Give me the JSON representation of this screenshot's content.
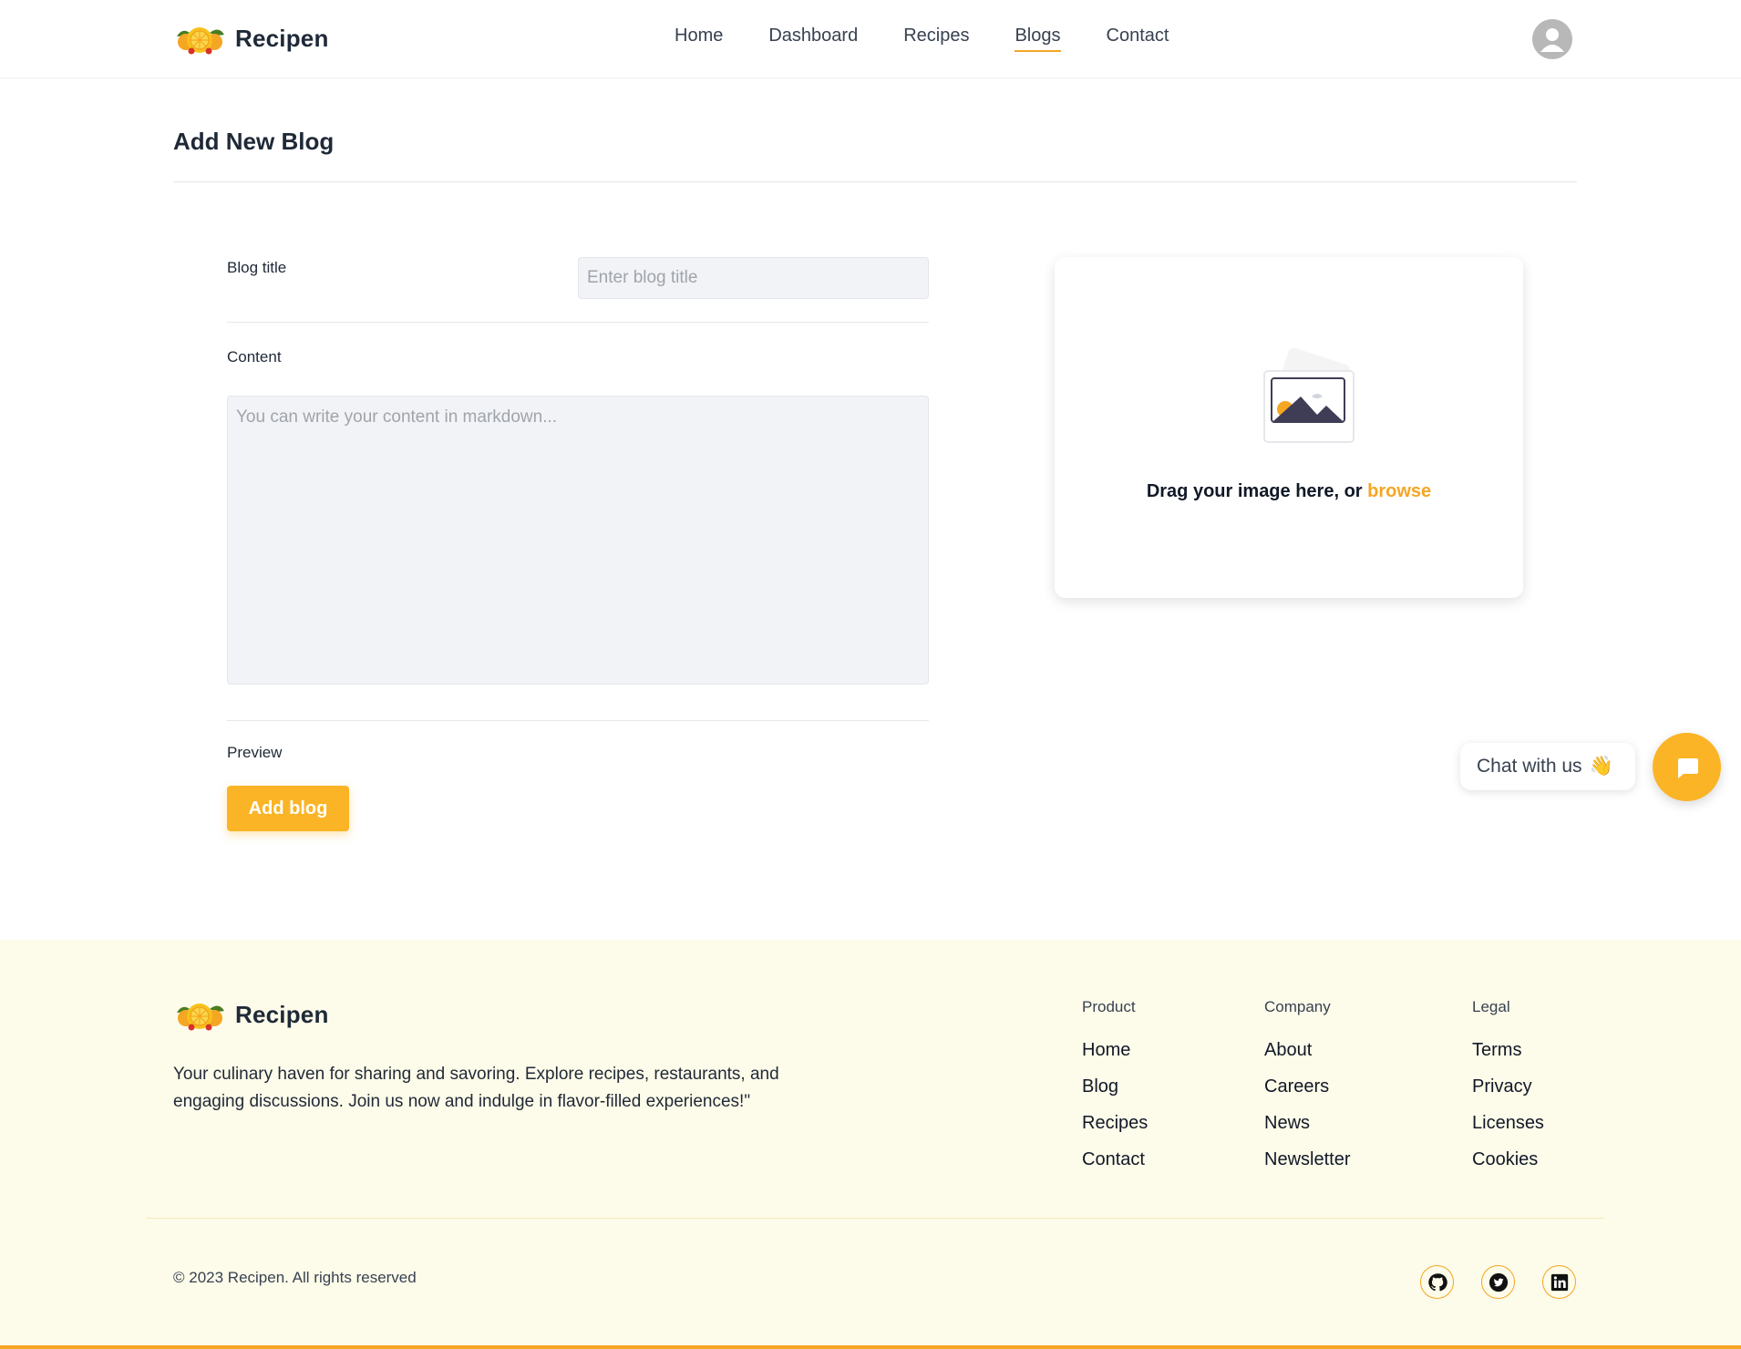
{
  "brand": {
    "name": "Recipen",
    "logo_icon": "citrus-logo-icon"
  },
  "nav": {
    "items": [
      {
        "label": "Home",
        "active": false
      },
      {
        "label": "Dashboard",
        "active": false
      },
      {
        "label": "Recipes",
        "active": false
      },
      {
        "label": "Blogs",
        "active": true
      },
      {
        "label": "Contact",
        "active": false
      }
    ],
    "avatar_icon": "user-avatar-icon"
  },
  "page": {
    "title": "Add New Blog"
  },
  "form": {
    "title_label": "Blog title",
    "title_placeholder": "Enter blog title",
    "title_value": "",
    "content_label": "Content",
    "content_placeholder": "You can write your content in markdown...",
    "content_value": "",
    "preview_label": "Preview",
    "submit_label": "Add blog"
  },
  "dropzone": {
    "text": "Drag your image here, or ",
    "browse": "browse",
    "icon": "image-placeholder-icon"
  },
  "chat": {
    "label": "Chat with us",
    "emoji": "👋",
    "button_icon": "chat-bubble-icon"
  },
  "footer": {
    "brand_name": "Recipen",
    "description": "Your culinary haven for sharing and savoring. Explore recipes, restaurants, and engaging discussions. Join us now and indulge in flavor-filled experiences!\"",
    "columns": [
      {
        "heading": "Product",
        "links": [
          "Home",
          "Blog",
          "Recipes",
          "Contact"
        ]
      },
      {
        "heading": "Company",
        "links": [
          "About",
          "Careers",
          "News",
          "Newsletter"
        ]
      },
      {
        "heading": "Legal",
        "links": [
          "Terms",
          "Privacy",
          "Licenses",
          "Cookies"
        ]
      }
    ],
    "copyright": "© 2023 Recipen. All rights reserved",
    "social": [
      "github-icon",
      "twitter-icon",
      "linkedin-icon"
    ]
  },
  "colors": {
    "accent": "#fbb425",
    "footer_bg": "#fdfbe9",
    "text": "#1f2937"
  }
}
